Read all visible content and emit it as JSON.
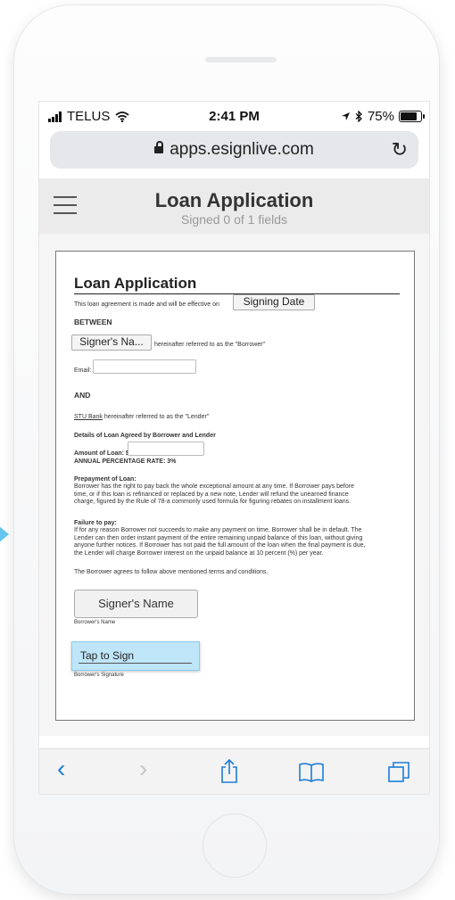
{
  "status": {
    "carrier": "TELUS",
    "time": "2:41 PM",
    "battery": "75%",
    "battery_level": 0.75
  },
  "browser": {
    "url": "apps.esignlive.com"
  },
  "header": {
    "title": "Loan Application",
    "subtitle": "Signed 0 of 1 fields"
  },
  "doc": {
    "title": "Loan Application",
    "intro": "This loan agreement is made and will be effective on",
    "signing_date": "Signing Date",
    "between": "BETWEEN",
    "signer_short": "Signer's Na...",
    "borrower_ref": "hereinafter referred to as the \"Borrower\"",
    "email_label": "Email:",
    "and": "AND",
    "lender_name": "STU Bank",
    "lender_ref": "hereinafter referred to as the \"Lender\"",
    "details_heading": "Details of Loan Agreed by Borrower and Lender",
    "amount_label": "Amount of Loan: $",
    "apr": "ANNUAL PERCENTAGE RATE: 3%",
    "prepayment_heading": "Prepayment of Loan:",
    "prepayment_text": "Borrower has the right to pay back the whole exceptional amount at any time. If Borrower pays before time, or if this loan is refinanced or replaced by a new note, Lender will refund the unearned finance charge, figured by the Rule of 78-a commonly used formula for figuring rebates on installment loans.",
    "failure_heading": "Failure to pay:",
    "failure_text": "If for any reason Borrower not succeeds to make any payment on time, Borrower shall be in default. The Lender can then order instant payment of the entire remaining unpaid balance of this loan, without giving anyone further notices. If Borrower has not paid the full amount of the loan when the final payment is due, the Lender will charge Borrower interest on the unpaid balance at 10 percent (%) per year.",
    "agree_text": "The Borrower agrees to follow above mentioned terms and conditions.",
    "signer_name": "Signer's Name",
    "borrower_name_label": "Borrower's Name",
    "tap_to_sign": "Tap to Sign",
    "borrower_sig_label": "Borrower's Signature"
  },
  "icons": {
    "wifi": "wifi-icon",
    "location": "location-arrow-icon",
    "bluetooth": "bluetooth-icon",
    "reload": "reload-icon",
    "menu": "hamburger-icon",
    "back": "back-chevron-icon",
    "forward": "forward-chevron-icon",
    "share": "share-icon",
    "bookmarks": "bookmarks-icon",
    "tabs": "tabs-icon"
  },
  "colors": {
    "accent": "#1c7cd6",
    "tap_highlight": "#bfe5f8",
    "pointer": "#64c6ef"
  }
}
